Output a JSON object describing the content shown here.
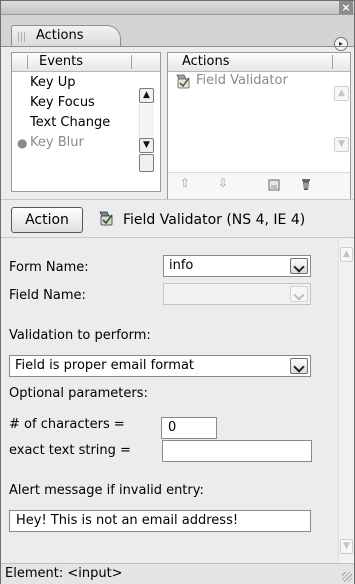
{
  "window": {
    "close_glyph": "×"
  },
  "panel": {
    "tab_label": "Actions",
    "menu_glyph": "▸"
  },
  "events": {
    "header": "Events",
    "items": [
      {
        "label": "Key Up",
        "disabled": false
      },
      {
        "label": "Key Focus",
        "disabled": false
      },
      {
        "label": "Text Change",
        "disabled": false
      },
      {
        "label": "Key Blur",
        "disabled": true
      }
    ]
  },
  "actions": {
    "header": "Actions",
    "items": [
      {
        "label": "Field Validator",
        "icon": "field-validator-icon"
      }
    ],
    "toolbar": [
      "move-up-icon",
      "move-down-icon",
      "save-icon",
      "trash-icon"
    ]
  },
  "action_bar": {
    "button_label": "Action",
    "behavior_title": "Field Validator (NS 4, IE 4)"
  },
  "form": {
    "form_name_label": "Form Name:",
    "form_name_value": "info",
    "field_name_label": "Field Name:",
    "field_name_value": "",
    "validation_label": "Validation to perform:",
    "validation_value": "Field is proper email format",
    "optional_label": "Optional parameters:",
    "chars_label": "# of characters =",
    "chars_value": "0",
    "exact_label": "exact text string =",
    "exact_value": "",
    "alert_label": "Alert message if invalid entry:",
    "alert_value": "Hey! This is not an email address!"
  },
  "status": {
    "element_text": "Element: <input>"
  }
}
